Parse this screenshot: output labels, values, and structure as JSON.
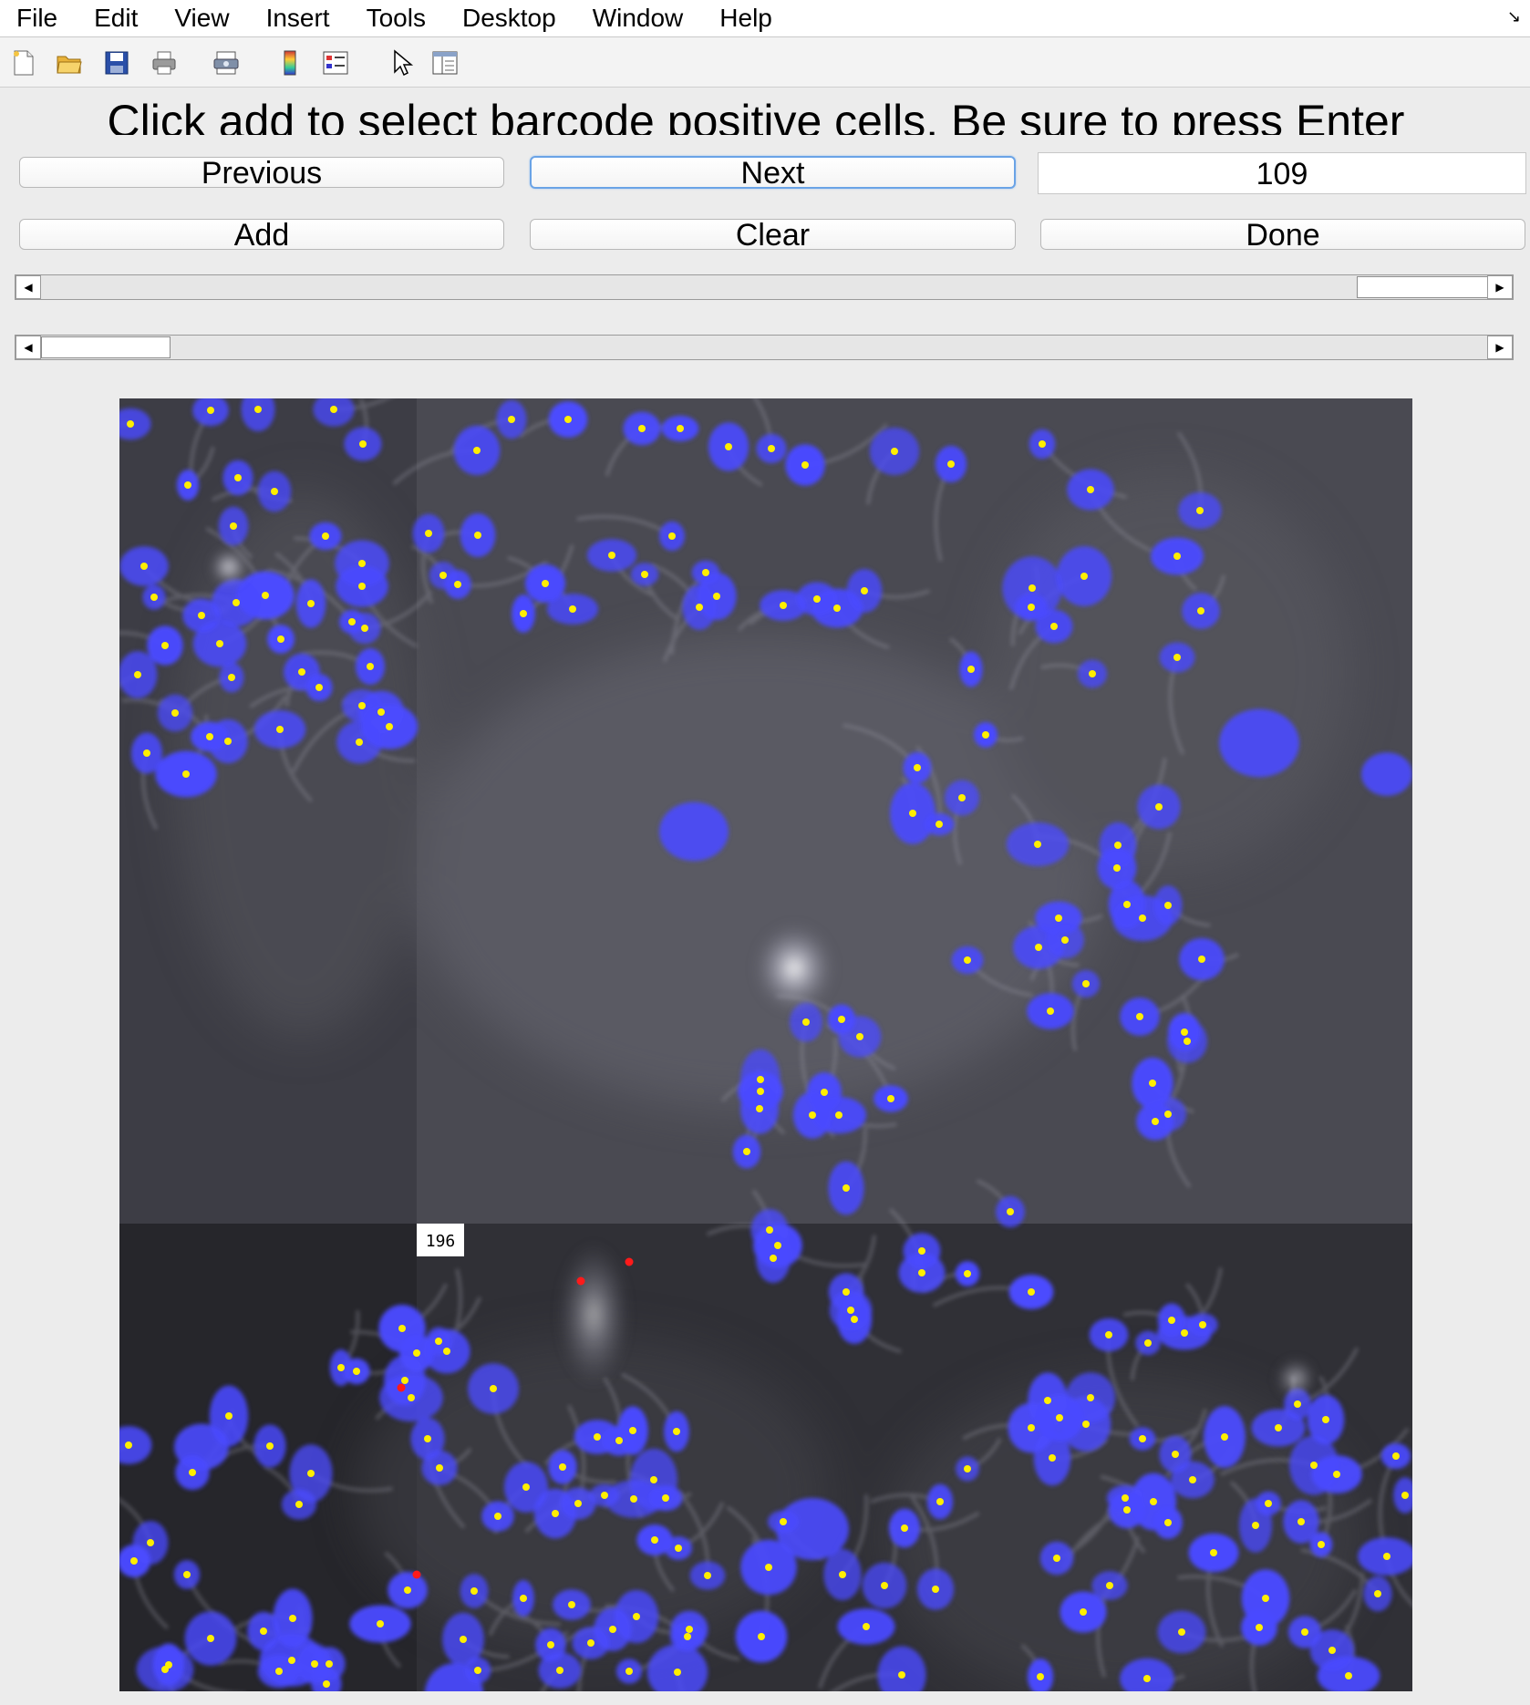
{
  "menu": [
    "File",
    "Edit",
    "View",
    "Insert",
    "Tools",
    "Desktop",
    "Window",
    "Help"
  ],
  "toolbar_icons": [
    "new-file-icon",
    "open-folder-icon",
    "save-icon",
    "print-icon",
    "print-preview-icon",
    "colorbar-icon",
    "legend-icon",
    "pointer-icon",
    "property-inspector-icon"
  ],
  "instruction": "Click add to select barcode positive cells. Be sure to press Enter",
  "buttons": {
    "previous": "Previous",
    "next": "Next",
    "add": "Add",
    "clear": "Clear",
    "done": "Done"
  },
  "index_value": "109",
  "sliders": {
    "horizontal_1": {
      "value": 0.97
    },
    "horizontal_2": {
      "value": 0.0
    }
  },
  "image": {
    "label": "196",
    "marker_colors": {
      "detected": "#ffee00",
      "selected": "#ff1a1a",
      "nucleus": "#4a4aff"
    }
  }
}
